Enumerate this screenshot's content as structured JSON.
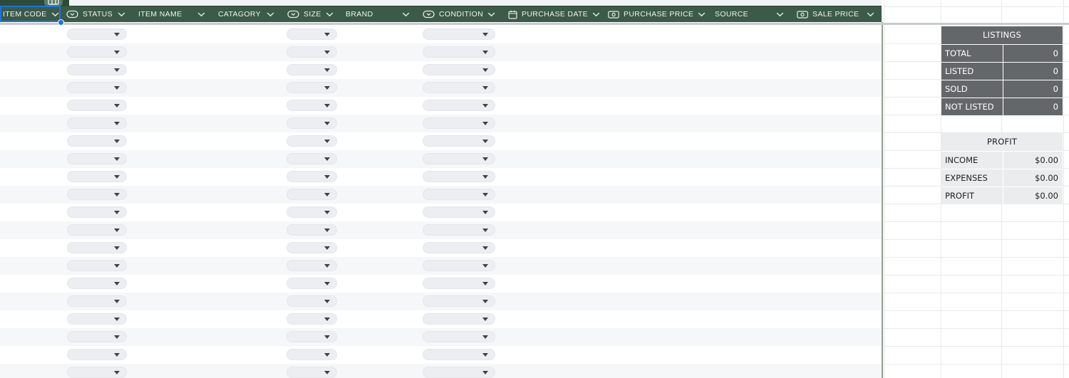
{
  "app": {
    "type": "spreadsheet inventory tracker"
  },
  "table": {
    "selected_header_cell": "ITEM CODE",
    "columns": [
      {
        "label": "ITEM CODE",
        "icon": null
      },
      {
        "label": "STATUS",
        "icon": "dropdown-chip"
      },
      {
        "label": "ITEM NAME",
        "icon": null
      },
      {
        "label": "CATAGORY",
        "icon": null
      },
      {
        "label": "SIZE",
        "icon": "dropdown-chip"
      },
      {
        "label": "BRAND",
        "icon": null
      },
      {
        "label": "CONDITION",
        "icon": "dropdown-chip"
      },
      {
        "label": "PURCHASE DATE",
        "icon": "calendar"
      },
      {
        "label": "PURCHASE PRICE",
        "icon": "money"
      },
      {
        "label": "SOURCE",
        "icon": null
      },
      {
        "label": "SALE PRICE",
        "icon": "money"
      }
    ],
    "rows_visible": 20,
    "dropdown_columns": [
      "STATUS",
      "SIZE",
      "CONDITION"
    ],
    "dropdown_cell_value": ""
  },
  "summary": {
    "listings": {
      "title": "LISTINGS",
      "rows": [
        {
          "label": "TOTAL",
          "value": "0"
        },
        {
          "label": "LISTED",
          "value": "0"
        },
        {
          "label": "SOLD",
          "value": "0"
        },
        {
          "label": "NOT LISTED",
          "value": "0"
        }
      ]
    },
    "profit": {
      "title": "PROFIT",
      "rows": [
        {
          "label": "INCOME",
          "value": "$0.00"
        },
        {
          "label": "EXPENSES",
          "value": "$0.00"
        },
        {
          "label": "PROFIT",
          "value": "$0.00"
        }
      ]
    }
  },
  "colors": {
    "header_green": "#3b5a47",
    "tab_green": "#2c4a38",
    "tab_icon_green": "#587c63",
    "accent_blue": "#1a73e8",
    "band_gray": "#f6f7f9",
    "pill_gray": "#eceef1",
    "pill_arrow": "#3f4247",
    "divider_gray": "#c9cacc",
    "gridline": "#e7e9ea",
    "table_border": "#8fa093",
    "listings_bg": "#646769",
    "profit_bg": "#eaeced",
    "header_icon": "#e6ece7"
  }
}
